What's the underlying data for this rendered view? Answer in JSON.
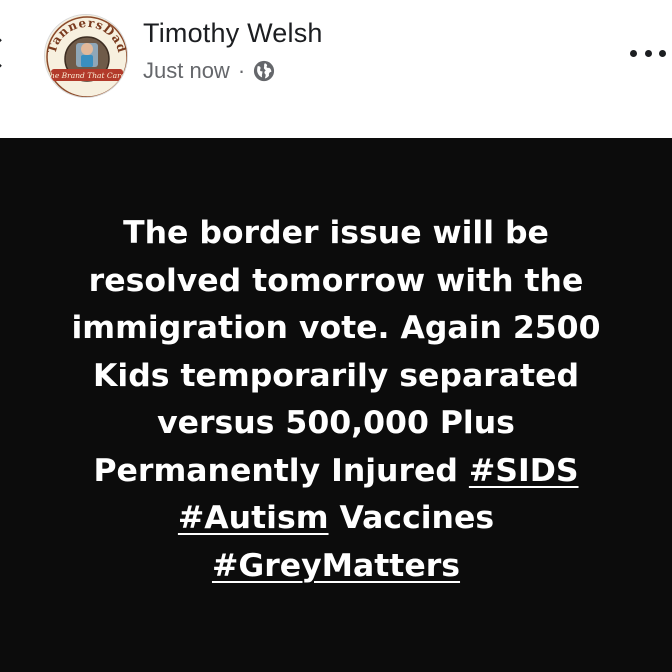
{
  "author": {
    "name": "Timothy Welsh",
    "avatar": {
      "top_text": "TannersDad",
      "bottom_text": "The Brand That Cares"
    }
  },
  "post_meta": {
    "timestamp": "Just now",
    "separator": "·",
    "privacy_icon": "globe-icon"
  },
  "header_icons": {
    "back": "chevron-left-icon",
    "more": "more-horizontal-icon"
  },
  "post": {
    "background_color": "#0c0c0c",
    "text_color": "#ffffff",
    "lines": [
      {
        "text": "The border issue will be"
      },
      {
        "text": "resolved tomorrow with the"
      },
      {
        "text": "immigration vote. Again 2500"
      },
      {
        "text": "Kids temporarily separated"
      },
      {
        "text": "versus 500,000 Plus"
      },
      {
        "pre": "Permanently Injured ",
        "tag": "#SIDS",
        "post": ""
      },
      {
        "pre": "",
        "tag": "#Autism",
        "post": " Vaccines"
      },
      {
        "pre": "",
        "tag": "#GreyMatters",
        "post": ""
      }
    ]
  }
}
